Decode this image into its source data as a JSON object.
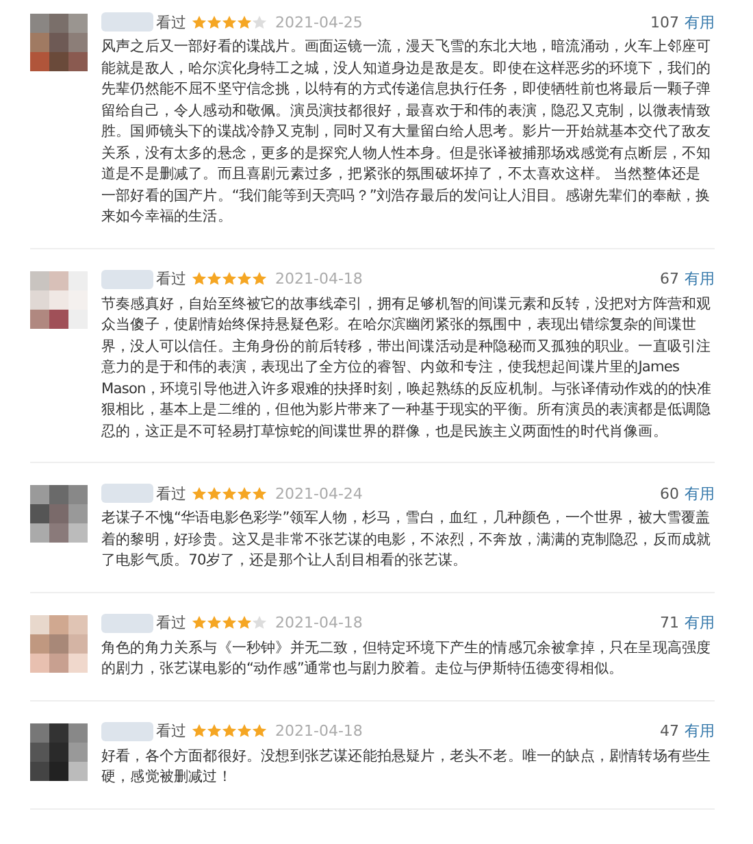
{
  "reviews": [
    {
      "status": "看过",
      "stars": 4,
      "date": "2021-04-25",
      "votes": "107",
      "useful": "有用",
      "text": "风声之后又一部好看的谍战片。画面运镜一流，漫天飞雪的东北大地，暗流涌动，火车上邻座可能就是敌人，哈尔滨化身特工之城，没人知道身边是敌是友。即使在这样恶劣的环境下，我们的先辈仍然能不屈不坚守信念挑，以特有的方式传递信息执行任务，即使牺牲前也将最后一颗子弹留给自己，令人感动和敬佩。演员演技都很好，最喜欢于和伟的表演，隐忍又克制，以微表情致胜。国师镜头下的谍战冷静又克制，同时又有大量留白给人思考。影片一开始就基本交代了敌友关系，没有太多的悬念，更多的是探究人物人性本身。但是张译被捕那场戏感觉有点断层，不知道是不是删减了。而且喜剧元素过多，把紧张的氛围破坏掉了，不太喜欢这样。 当然整体还是一部好看的国产片。“我们能等到天亮吗？”刘浩存最后的发问让人泪目。感谢先辈们的奉献，换来如今幸福的生活。"
    },
    {
      "status": "看过",
      "stars": 5,
      "date": "2021-04-18",
      "votes": "67",
      "useful": "有用",
      "text": "节奏感真好，自始至终被它的故事线牵引，拥有足够机智的间谍元素和反转，没把对方阵营和观众当傻子，使剧情始终保持悬疑色彩。在哈尔滨幽闭紧张的氛围中，表现出错综复杂的间谍世界，没人可以信任。主角身份的前后转移，带出间谍活动是种隐秘而又孤独的职业。一直吸引注意力的是于和伟的表演，表现出了全方位的睿智、内敛和专注，使我想起间谍片里的James Mason，环境引导他进入许多艰难的抉择时刻，唤起熟练的反应机制。与张译倩动作戏的的快准狠相比，基本上是二维的，但他为影片带来了一种基于现实的平衡。所有演员的表演都是低调隐忍的，这正是不可轻易打草惊蛇的间谍世界的群像，也是民族主义两面性的时代肖像画。"
    },
    {
      "status": "看过",
      "stars": 5,
      "date": "2021-04-24",
      "votes": "60",
      "useful": "有用",
      "text": "老谋子不愧“华语电影色彩学”领军人物，杉马，雪白，血红，几种颜色，一个世界，被大雪覆盖着的黎明，好珍贵。这又是非常不张艺谋的电影，不浓烈，不奔放，满满的克制隐忍，反而成就了电影气质。70岁了，还是那个让人刮目相看的张艺谋。"
    },
    {
      "status": "看过",
      "stars": 4,
      "date": "2021-04-18",
      "votes": "71",
      "useful": "有用",
      "text": "角色的角力关系与《一秒钟》并无二致，但特定环境下产生的情感冗余被拿掉，只在呈现高强度的剧力，张艺谋电影的“动作感”通常也与剧力胶着。走位与伊斯特伍德变得相似。"
    },
    {
      "status": "看过",
      "stars": 5,
      "date": "2021-04-18",
      "votes": "47",
      "useful": "有用",
      "text": "好看，各个方面都很好。没想到张艺谋还能拍悬疑片，老头不老。唯一的缺点，剧情转场有些生硬，感觉被删减过！"
    }
  ]
}
